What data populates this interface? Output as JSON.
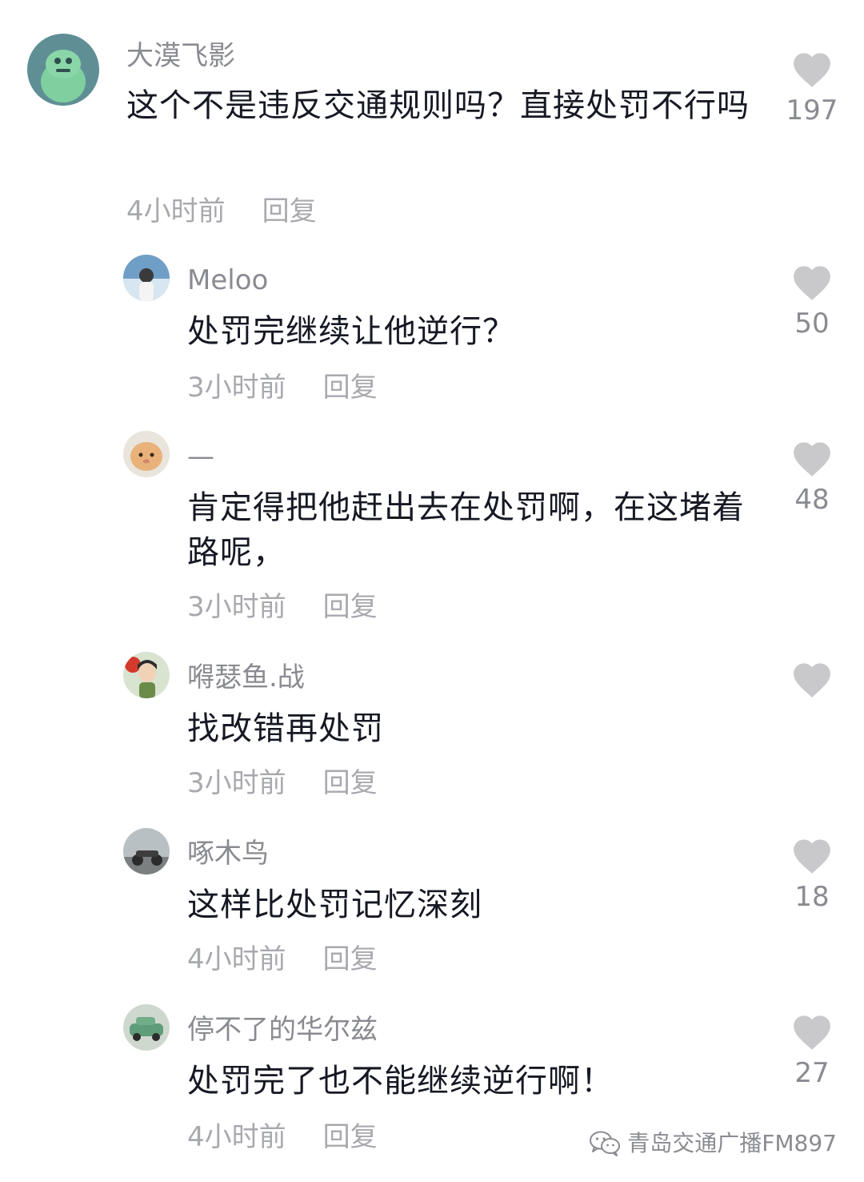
{
  "comments": [
    {
      "username": "大漠飞影",
      "text": "这个不是违反交通规则吗？直接处罚不行吗",
      "time": "4小时前",
      "reply": "回复",
      "likes": "197"
    },
    {
      "username": "Meloo",
      "text": "处罚完继续让他逆行？",
      "time": "3小时前",
      "reply": "回复",
      "likes": "50"
    },
    {
      "username": "—",
      "text": "肯定得把他赶出去在处罚啊，在这堵着路呢，",
      "time": "3小时前",
      "reply": "回复",
      "likes": "48"
    },
    {
      "username": "嘚瑟鱼.战",
      "text": "找改错再处罚",
      "time": "3小时前",
      "reply": "回复",
      "likes": ""
    },
    {
      "username": "啄木鸟",
      "text": "这样比处罚记忆深刻",
      "time": "4小时前",
      "reply": "回复",
      "likes": "18"
    },
    {
      "username": "停不了的华尔兹",
      "text": "处罚完了也不能继续逆行啊！",
      "time": "4小时前",
      "reply": "回复",
      "likes": "27"
    }
  ],
  "watermark": {
    "icon": "wechat-icon",
    "text": "青岛交通广播FM897"
  },
  "colors": {
    "text": "#161823",
    "secondary": "#8a8b91",
    "meta": "#a8a9ae",
    "heart": "#c9c9cc"
  }
}
